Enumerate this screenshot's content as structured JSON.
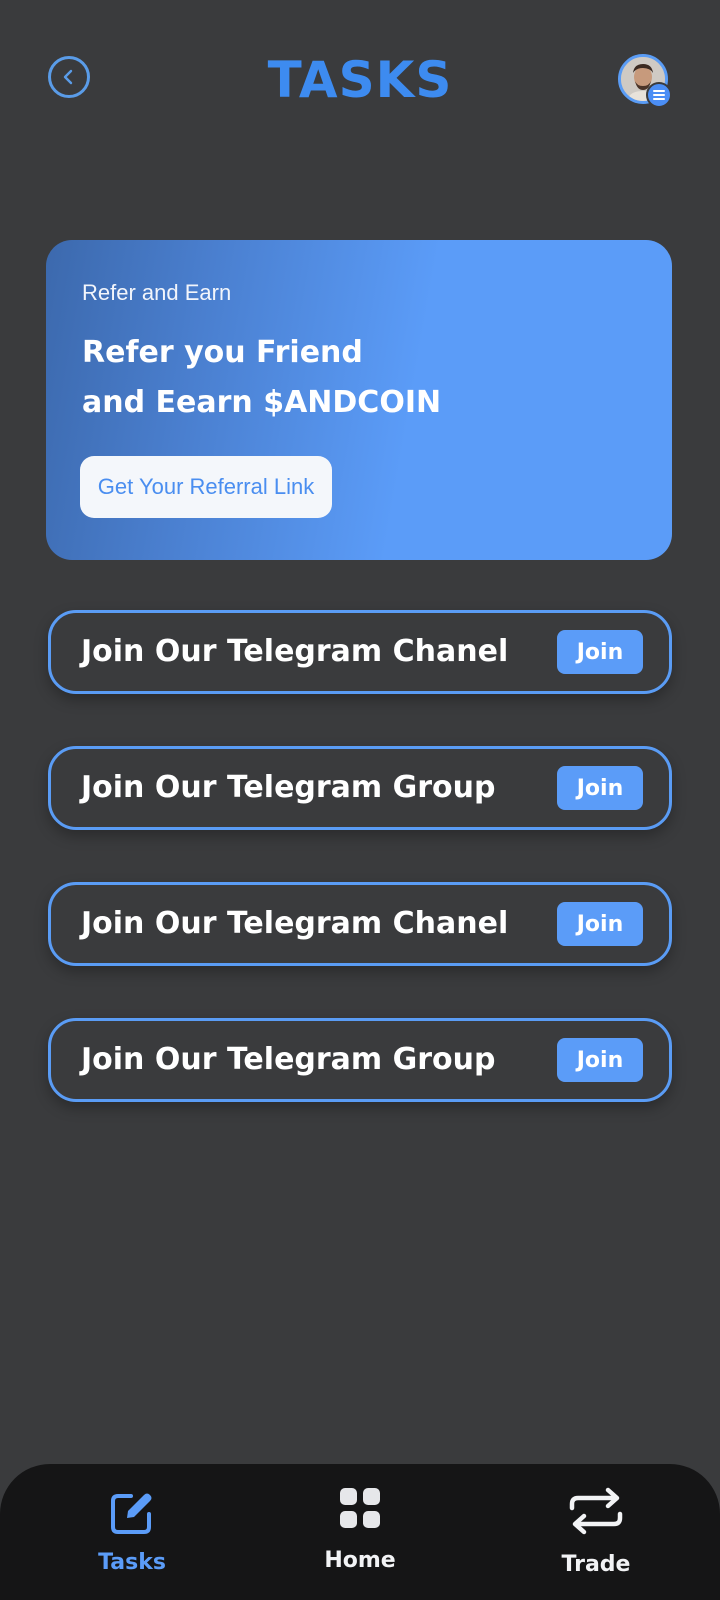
{
  "header": {
    "title": "TASKS",
    "back_icon": "chevron-left-icon",
    "avatar_badge_icon": "menu-icon"
  },
  "promo": {
    "eyebrow": "Refer and Earn",
    "headline_line1": "Refer you Friend",
    "headline_line2": "and Eearn $ANDCOIN",
    "button_label": "Get Your Referral Link"
  },
  "tasks": [
    {
      "label": "Join Our Telegram Chanel",
      "button": "Join"
    },
    {
      "label": "Join Our Telegram Group",
      "button": "Join"
    },
    {
      "label": "Join Our Telegram Chanel",
      "button": "Join"
    },
    {
      "label": "Join Our Telegram Group",
      "button": "Join"
    }
  ],
  "nav": {
    "items": [
      {
        "label": "Tasks",
        "icon": "edit-icon",
        "active": true
      },
      {
        "label": "Home",
        "icon": "grid-icon",
        "active": false
      },
      {
        "label": "Trade",
        "icon": "swap-icon",
        "active": false
      }
    ]
  },
  "colors": {
    "background": "#3a3b3d",
    "accent": "#5b9cf8",
    "title": "#3d8bf0",
    "nav_background": "#151516"
  }
}
